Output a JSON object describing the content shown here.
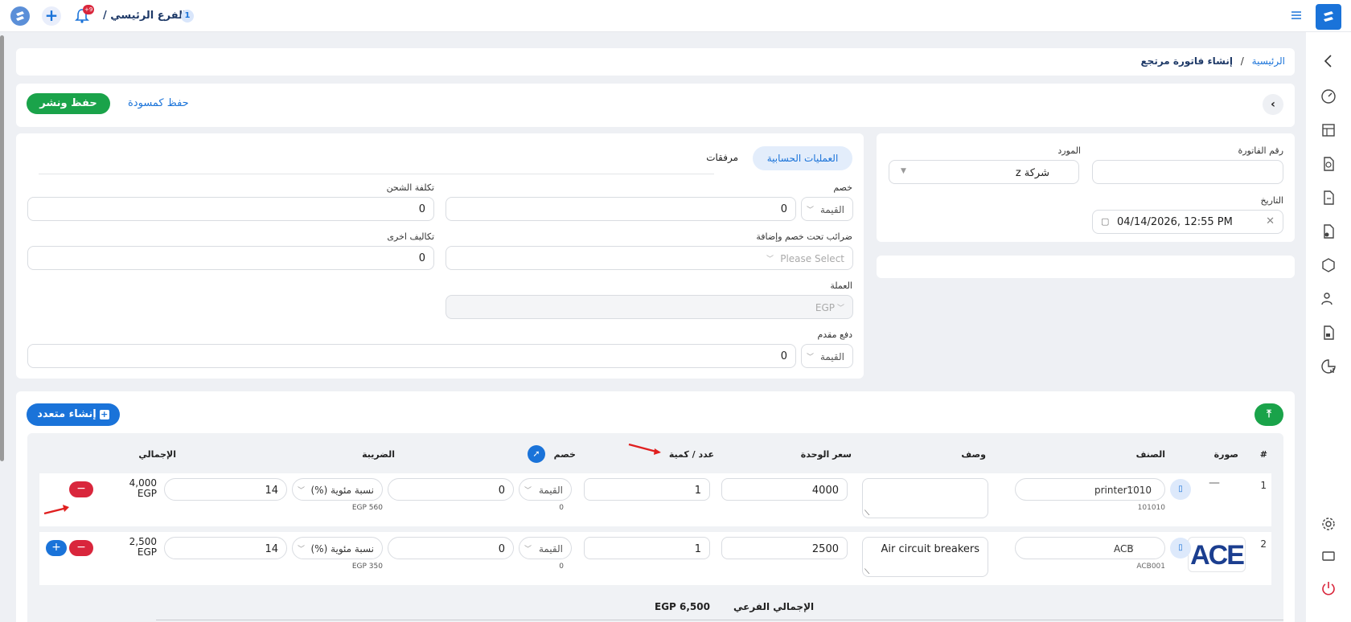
{
  "topbar": {
    "branch_count": "1",
    "branch_name": "الفرع الرئيسي /",
    "notif_count": "+9"
  },
  "breadcrumb": {
    "home": "الرئيسية",
    "sep": "/",
    "current": "إنشاء فاتورة مرتجع"
  },
  "actions": {
    "save_publish": "حفظ ونشر",
    "save_draft": "حفظ كمسودة"
  },
  "form": {
    "invoice_number_label": "رقم الفاتورة",
    "invoice_number_value": "",
    "supplier_label": "المورد",
    "supplier_value": "شركة z",
    "date_label": "التاريخ",
    "date_value": "04/14/2026, 12:55 PM"
  },
  "tabs": {
    "accounting": "العمليات الحسابية",
    "attachments": "مرفقات"
  },
  "accounting": {
    "discount_label": "خصم",
    "discount_type": "القيمة",
    "discount_value": "0",
    "shipping_label": "تكلفة الشحن",
    "shipping_value": "0",
    "taxes_label": "ضرائب تحت خصم وإضافة",
    "taxes_placeholder": "Please Select",
    "other_costs_label": "تكاليف اخرى",
    "other_costs_value": "0",
    "currency_label": "العملة",
    "currency_value": "EGP",
    "advance_label": "دفع مقدم",
    "advance_type": "القيمة",
    "advance_value": "0"
  },
  "items": {
    "bulk_create": "إنشاء متعدد",
    "headers": {
      "index": "#",
      "image": "صورة",
      "item": "الصنف",
      "description": "وصف",
      "unit_price": "سعر الوحدة",
      "quantity": "عدد / كمية",
      "discount": "خصم",
      "tax": "الضريبة",
      "total": "الإجمالي"
    },
    "rows": [
      {
        "index": "1",
        "image": "—",
        "item": "printer1010",
        "code": "101010",
        "description": "",
        "unit_price": "4000",
        "quantity": "1",
        "discount_type": "القيمة",
        "discount": "0",
        "discount_amount": "0",
        "tax_type": "نسبة مئوية (%)",
        "tax": "14",
        "tax_amount": "EGP 560",
        "total_value": "4,000",
        "total_currency": "EGP"
      },
      {
        "index": "2",
        "image": "ACE",
        "item": "ACB",
        "code": "ACB001",
        "description": "Air circuit breakers",
        "unit_price": "2500",
        "quantity": "1",
        "discount_type": "القيمة",
        "discount": "0",
        "discount_amount": "0",
        "tax_type": "نسبة مئوية (%)",
        "tax": "14",
        "tax_amount": "EGP 350",
        "total_value": "2,500",
        "total_currency": "EGP"
      }
    ],
    "subtotal_label": "الإجمالي الفرعي",
    "subtotal_value": "EGP 6,500"
  },
  "colors": {
    "primary": "#1a73d9",
    "success": "#1aa34a",
    "danger": "#d9263c"
  }
}
